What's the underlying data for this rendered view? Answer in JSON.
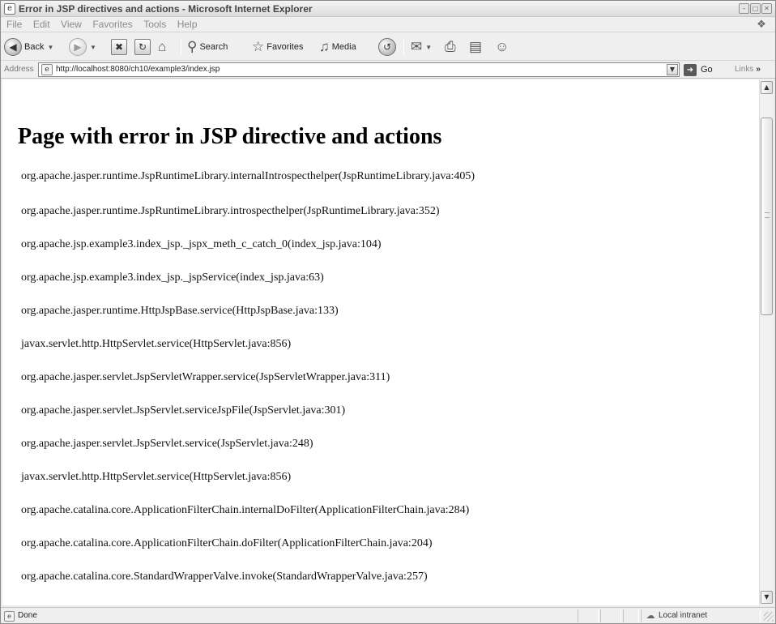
{
  "window": {
    "title": "Error in JSP directives and actions - Microsoft Internet Explorer",
    "icon": "ie-page-icon",
    "buttons": [
      "minimize",
      "maximize",
      "close"
    ]
  },
  "menubar": {
    "items": [
      "File",
      "Edit",
      "View",
      "Favorites",
      "Tools",
      "Help"
    ]
  },
  "toolbar": {
    "back_label": "Back",
    "search_label": "Search",
    "favorites_label": "Favorites",
    "media_label": "Media"
  },
  "address": {
    "label": "Address",
    "url": "http://localhost:8080/ch10/example3/index.jsp",
    "go_label": "Go",
    "links_label": "Links"
  },
  "page": {
    "heading": "Page with error in JSP directive and actions",
    "stack_trace": [
      "org.apache.jasper.runtime.JspRuntimeLibrary.internalIntrospecthelper(JspRuntimeLibrary.java:405)",
      "org.apache.jasper.runtime.JspRuntimeLibrary.introspecthelper(JspRuntimeLibrary.java:352)",
      "org.apache.jsp.example3.index_jsp._jspx_meth_c_catch_0(index_jsp.java:104)",
      "org.apache.jsp.example3.index_jsp._jspService(index_jsp.java:63)",
      "org.apache.jasper.runtime.HttpJspBase.service(HttpJspBase.java:133)",
      "javax.servlet.http.HttpServlet.service(HttpServlet.java:856)",
      "org.apache.jasper.servlet.JspServletWrapper.service(JspServletWrapper.java:311)",
      "org.apache.jasper.servlet.JspServlet.serviceJspFile(JspServlet.java:301)",
      "org.apache.jasper.servlet.JspServlet.service(JspServlet.java:248)",
      "javax.servlet.http.HttpServlet.service(HttpServlet.java:856)",
      "org.apache.catalina.core.ApplicationFilterChain.internalDoFilter(ApplicationFilterChain.java:284)",
      "org.apache.catalina.core.ApplicationFilterChain.doFilter(ApplicationFilterChain.java:204)",
      "org.apache.catalina.core.StandardWrapperValve.invoke(StandardWrapperValve.java:257)"
    ]
  },
  "statusbar": {
    "status": "Done",
    "zone": "Local intranet"
  }
}
